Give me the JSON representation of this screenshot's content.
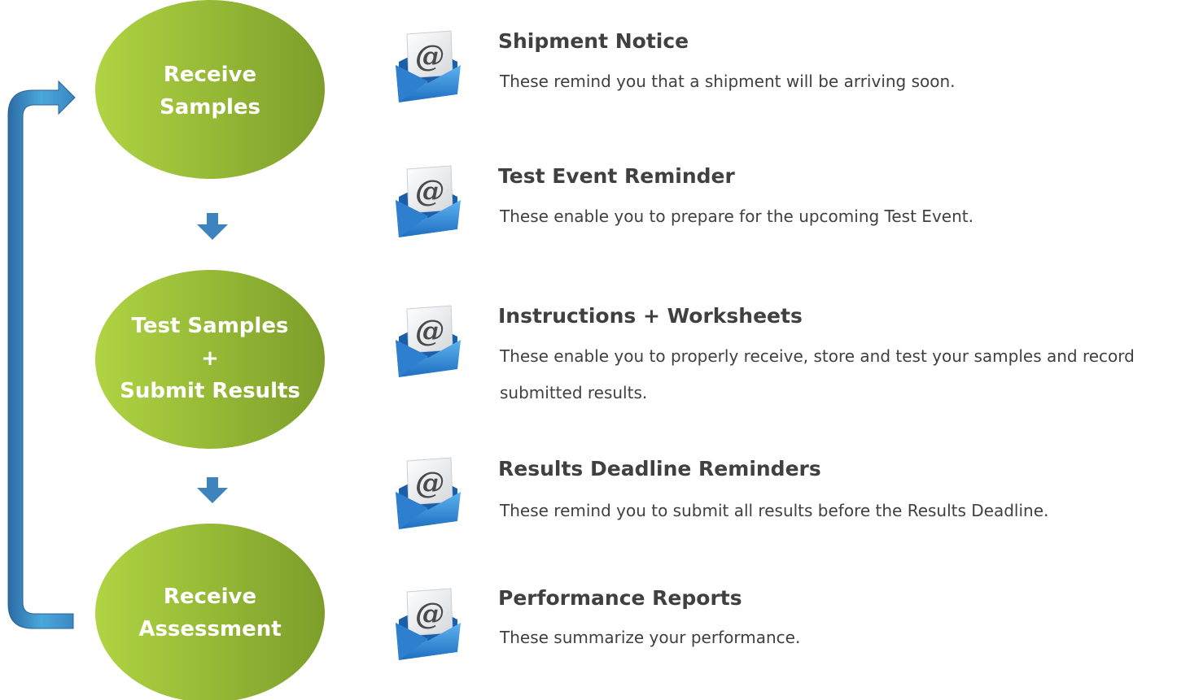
{
  "colors": {
    "ellipse_light": "#a9cc3f",
    "ellipse_dark": "#84a52c",
    "arrow_blue": "#3d84bf",
    "loop_light": "#4aa7d8",
    "loop_dark": "#2f6fa8",
    "text_dark": "#404040"
  },
  "steps": [
    {
      "lines": [
        "Receive",
        "Samples"
      ]
    },
    {
      "lines": [
        "Test Samples",
        "+",
        "Submit Results"
      ]
    },
    {
      "lines": [
        "Receive",
        "Assessment"
      ]
    }
  ],
  "notifications": [
    {
      "icon": "email-at-icon",
      "title": "Shipment Notice",
      "description": "These remind you that a shipment will be arriving soon."
    },
    {
      "icon": "email-at-icon",
      "title": "Test Event Reminder",
      "description": "These enable you to prepare for the upcoming Test Event."
    },
    {
      "icon": "email-at-icon",
      "title": "Instructions + Worksheets",
      "description": "These enable you to properly receive, store and test your samples and record submitted results."
    },
    {
      "icon": "email-at-icon",
      "title": "Results Deadline Reminders",
      "description": "These remind you to submit all results before the Results Deadline."
    },
    {
      "icon": "email-at-icon",
      "title": "Performance Reports",
      "description": "These summarize your performance."
    }
  ]
}
